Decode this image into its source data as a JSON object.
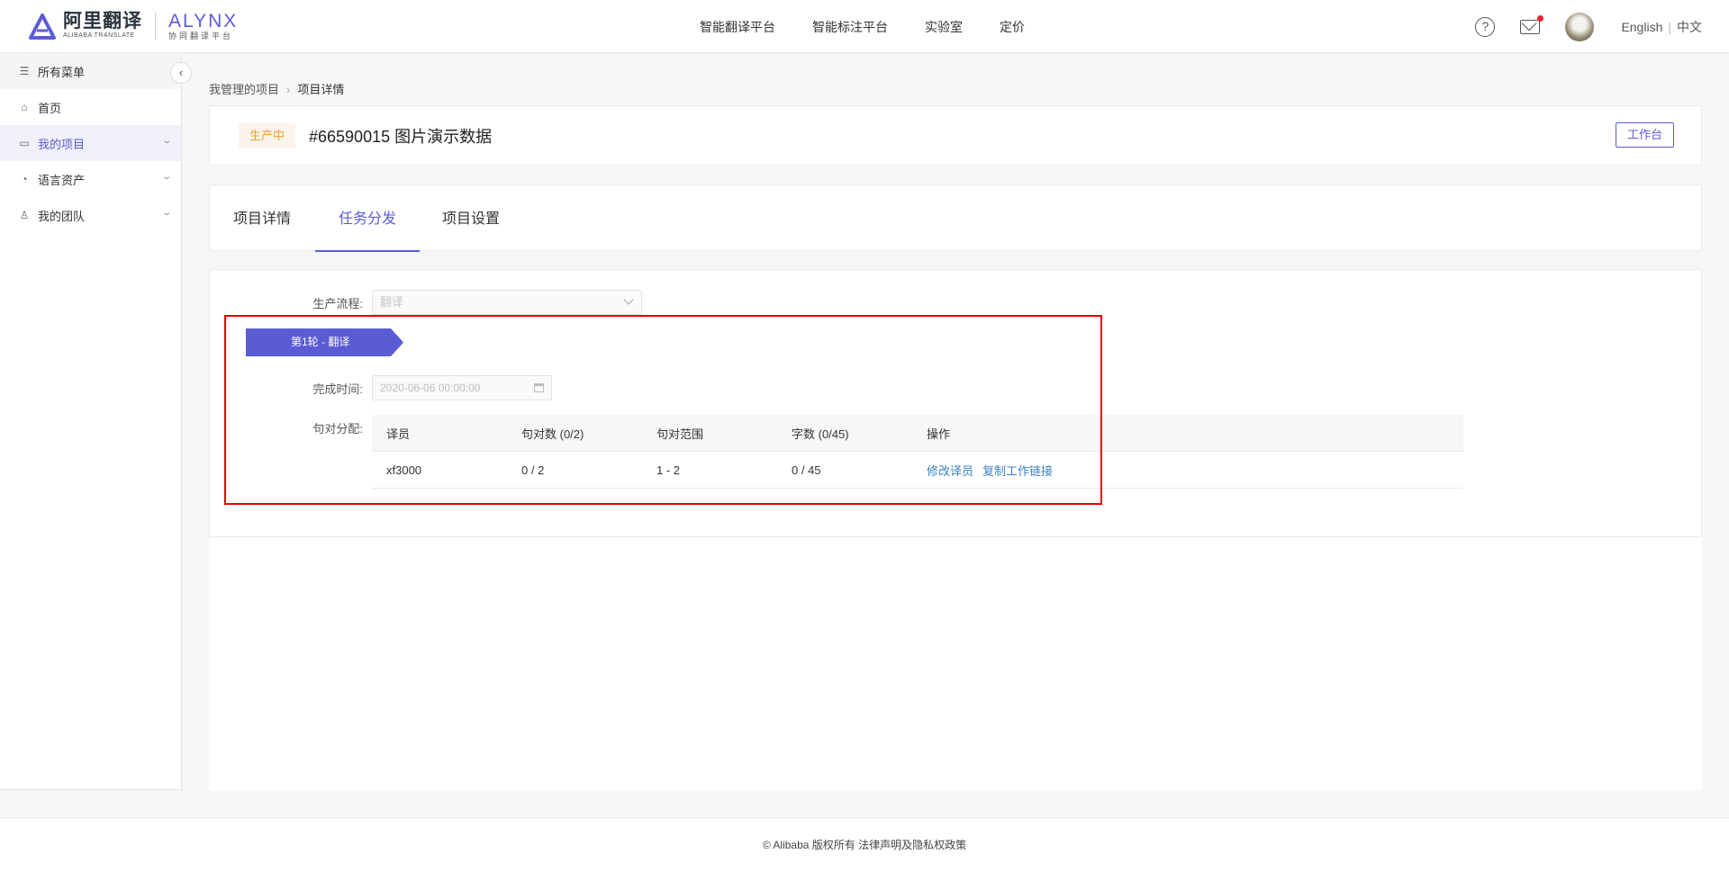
{
  "logo": {
    "cn_name": "阿里翻译",
    "cn_sub": "ALIBABA TRANSLATE",
    "en_name": "ALYNX",
    "en_sub": "协同翻译平台"
  },
  "topnav": [
    "智能翻译平台",
    "智能标注平台",
    "实验室",
    "定价"
  ],
  "header_right": {
    "help_icon": "?",
    "lang_en": "English",
    "lang_sep": "|",
    "lang_cn": "中文"
  },
  "sidebar": {
    "items": [
      {
        "label": "所有菜单",
        "icon": "list-icon"
      },
      {
        "label": "首页",
        "icon": "home-icon"
      },
      {
        "label": "我的项目",
        "icon": "folder-icon"
      },
      {
        "label": "语言资产",
        "icon": "pie-icon"
      },
      {
        "label": "我的团队",
        "icon": "user-icon"
      }
    ]
  },
  "breadcrumb": {
    "parent": "我管理的项目",
    "sep": "›",
    "current": "项目详情"
  },
  "project": {
    "status": "生产中",
    "title": "#66590015 图片演示数据",
    "workbench_button": "工作台"
  },
  "tabs": [
    "项目详情",
    "任务分发",
    "项目设置"
  ],
  "form": {
    "flow_label": "生产流程:",
    "flow_placeholder": "翻译",
    "round_tag": "第1轮 - 翻译",
    "deadline_label": "完成时间:",
    "deadline_value": "2020-06-06 00:00:00",
    "assign_label": "句对分配:"
  },
  "table": {
    "headers": [
      "译员",
      "句对数 (0/2)",
      "句对范围",
      "字数 (0/45)",
      "操作"
    ],
    "rows": [
      {
        "translator": "xf3000",
        "pairs": "0 / 2",
        "range": "1 - 2",
        "words": "0 / 45",
        "action1": "修改译员",
        "action2": "复制工作链接"
      }
    ]
  },
  "footer": "© Alibaba 版权所有 法律声明及隐私权政策",
  "colors": {
    "accent": "#5b5bd6",
    "status_orange": "#f0a030",
    "link": "#3b82c4",
    "highlight_red": "#e60000"
  }
}
